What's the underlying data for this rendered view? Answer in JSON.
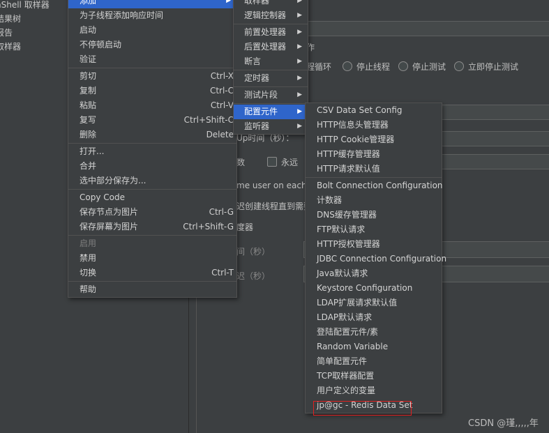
{
  "tree": {
    "items": [
      "nShell 取样器",
      "结果树",
      "报告",
      "取样器"
    ]
  },
  "editor": {
    "section_label": "作",
    "loop_radio_label": "程循环",
    "stop_thread_label": "停止线程",
    "stop_test_label": "停止测试",
    "stop_test_now_label": "立即停止测试",
    "rampup_label": "Up时间（秒）：",
    "loop_count_label": "数",
    "forever_label": "永远",
    "same_user_label": "me user on each it",
    "delay_thread_label": "迟创建线程直到需要",
    "scheduler_label": "度器",
    "duration_label": "间（秒）",
    "startup_delay_label": "迟（秒）"
  },
  "context_menu": {
    "add_label": "添加",
    "items": [
      {
        "label": "为子线程添加响应时间",
        "shortcut": ""
      },
      {
        "label": "启动",
        "shortcut": ""
      },
      {
        "label": "不停顿启动",
        "shortcut": ""
      },
      {
        "label": "验证",
        "shortcut": ""
      },
      {
        "label": "剪切",
        "shortcut": "Ctrl-X"
      },
      {
        "label": "复制",
        "shortcut": "Ctrl-C"
      },
      {
        "label": "粘贴",
        "shortcut": "Ctrl-V"
      },
      {
        "label": "复写",
        "shortcut": "Ctrl+Shift-C"
      },
      {
        "label": "删除",
        "shortcut": "Delete"
      },
      {
        "label": "打开...",
        "shortcut": ""
      },
      {
        "label": "合并",
        "shortcut": ""
      },
      {
        "label": "选中部分保存为...",
        "shortcut": ""
      },
      {
        "label": "Copy Code",
        "shortcut": ""
      },
      {
        "label": "保存节点为图片",
        "shortcut": "Ctrl-G"
      },
      {
        "label": "保存屏幕为图片",
        "shortcut": "Ctrl+Shift-G"
      },
      {
        "label": "启用",
        "shortcut": ""
      },
      {
        "label": "禁用",
        "shortcut": ""
      },
      {
        "label": "切换",
        "shortcut": "Ctrl-T"
      },
      {
        "label": "帮助",
        "shortcut": ""
      }
    ]
  },
  "add_submenu": {
    "items": [
      "取样器",
      "逻辑控制器",
      "前置处理器",
      "后置处理器",
      "断言",
      "定时器",
      "测试片段",
      "配置元件",
      "监听器"
    ]
  },
  "config_submenu": {
    "items": [
      "CSV Data Set Config",
      "HTTP信息头管理器",
      "HTTP Cookie管理器",
      "HTTP缓存管理器",
      "HTTP请求默认值",
      "Bolt Connection Configuration",
      "计数器",
      "DNS缓存管理器",
      "FTP默认请求",
      "HTTP授权管理器",
      "JDBC Connection Configuration",
      "Java默认请求",
      "Keystore Configuration",
      "LDAP扩展请求默认值",
      "LDAP默认请求",
      "登陆配置元件/素",
      "Random Variable",
      "简单配置元件",
      "TCP取样器配置",
      "用户定义的变量",
      "jp@gc - Redis Data Set"
    ]
  },
  "colors": {
    "background": "#3c3f41",
    "selection": "#2f65ca",
    "highlight_box": "#e02020"
  },
  "watermark": "CSDN @瑾,,,,,年"
}
